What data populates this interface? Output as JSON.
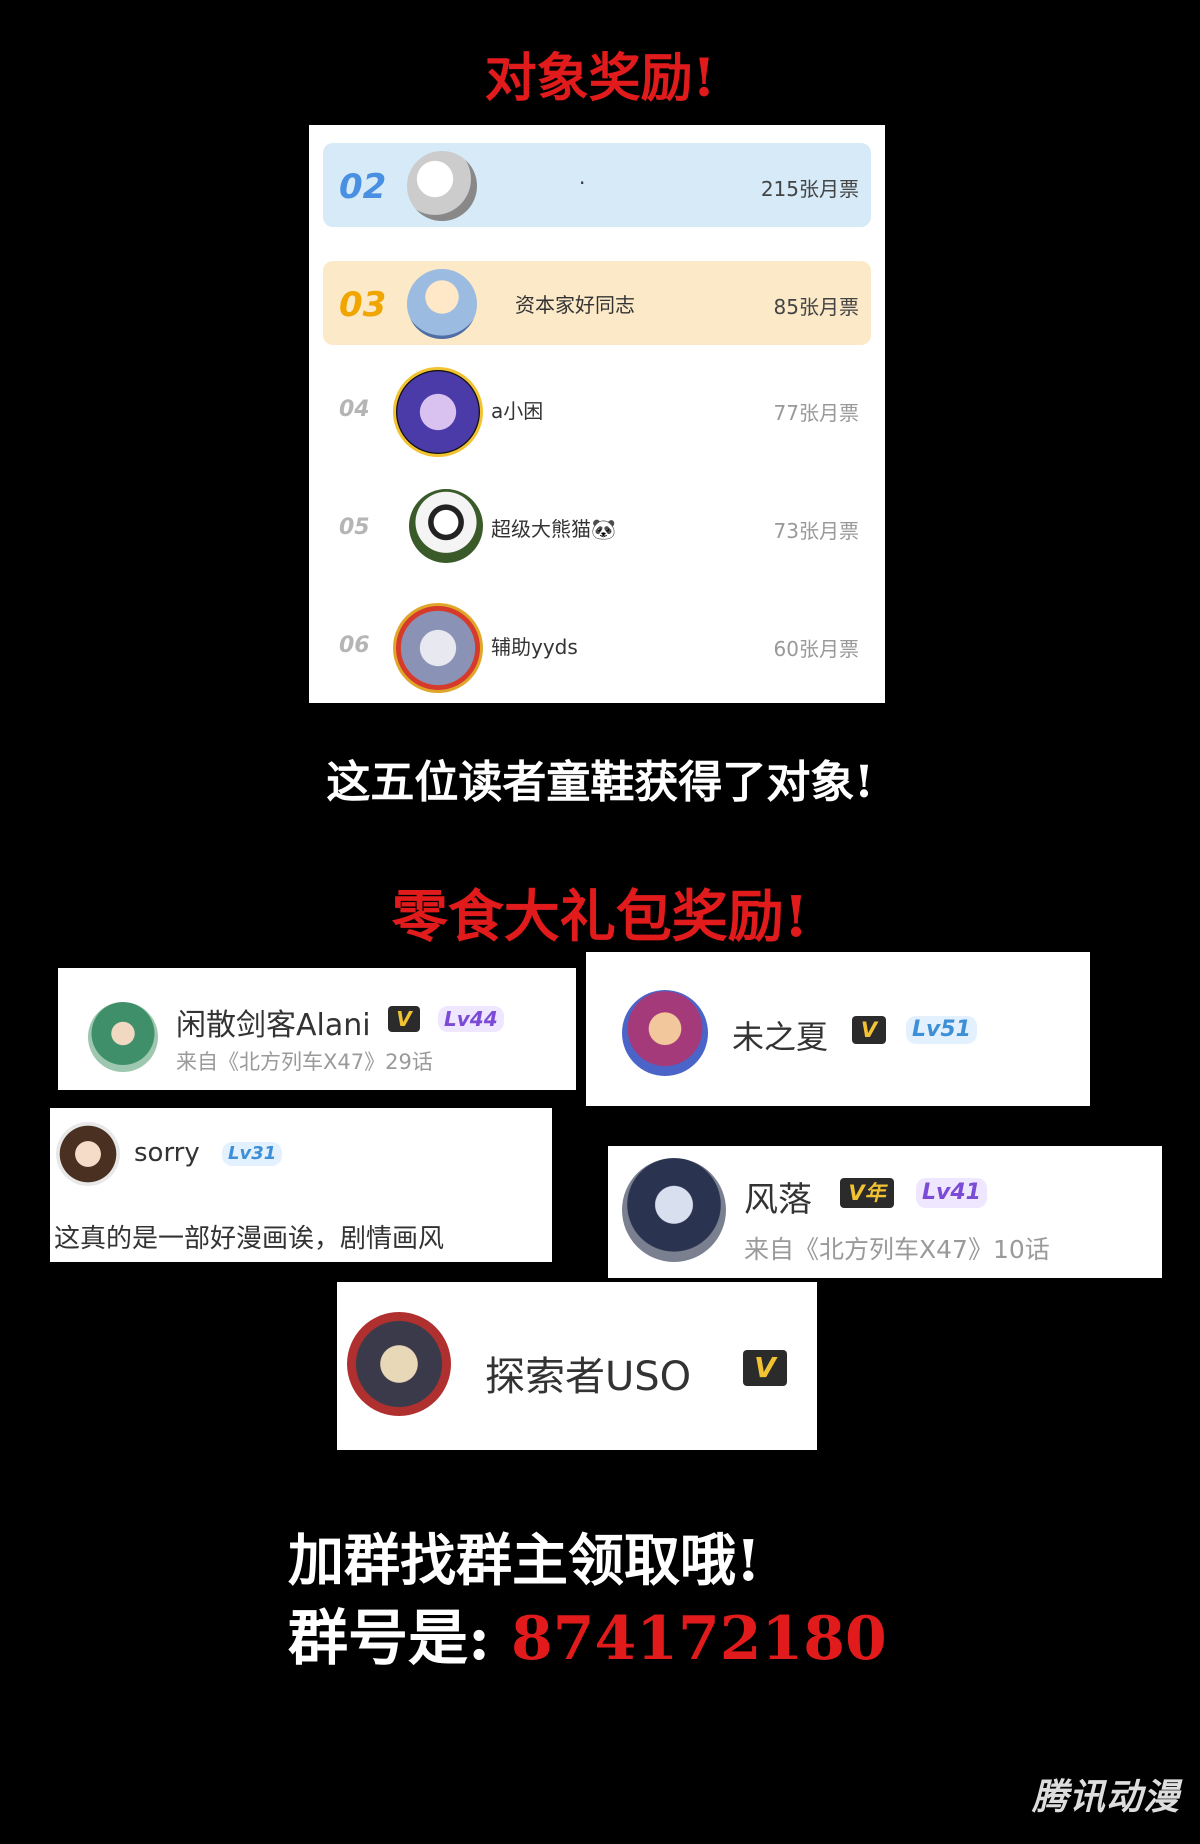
{
  "headings": {
    "partner_reward": "对象奖励!",
    "partner_winners": "这五位读者童鞋获得了对象!",
    "snack_reward": "零食大礼包奖励!",
    "join_group": "加群找群主领取哦!",
    "group_prefix": "群号是:",
    "group_number": "874172180"
  },
  "ranking": [
    {
      "rank": "02",
      "name": "·",
      "votes": "215张月票",
      "bg": "#d6eaf8",
      "rank_color": "#4a90e2"
    },
    {
      "rank": "03",
      "name": "资本家好同志",
      "votes": "85张月票",
      "bg": "#fbe9c8",
      "rank_color": "#f0a500"
    },
    {
      "rank": "04",
      "name": "a小困",
      "votes": "77张月票"
    },
    {
      "rank": "05",
      "name": "超级大熊猫🐼",
      "votes": "73张月票"
    },
    {
      "rank": "06",
      "name": "辅助yyds",
      "votes": "60张月票"
    }
  ],
  "comments": [
    {
      "name": "闲散剑客Alani",
      "vip": "V",
      "level": "Lv44",
      "source": "来自《北方列车X47》29话"
    },
    {
      "name": "未之夏",
      "vip": "V",
      "level": "Lv51"
    },
    {
      "name": "sorry",
      "level": "Lv31",
      "text": "这真的是一部好漫画诶，剧情画风"
    },
    {
      "name": "风落",
      "vip": "V年",
      "level": "Lv41",
      "source": "来自《北方列车X47》10话"
    },
    {
      "name": "探索者USO",
      "vip": "V"
    }
  ],
  "watermark": "腾讯动漫",
  "colors": {
    "accent_red": "#e11b1b",
    "vip_gold": "#f1c232",
    "level_purple": "#7b4bd6",
    "level_blue": "#3d8fd6"
  }
}
